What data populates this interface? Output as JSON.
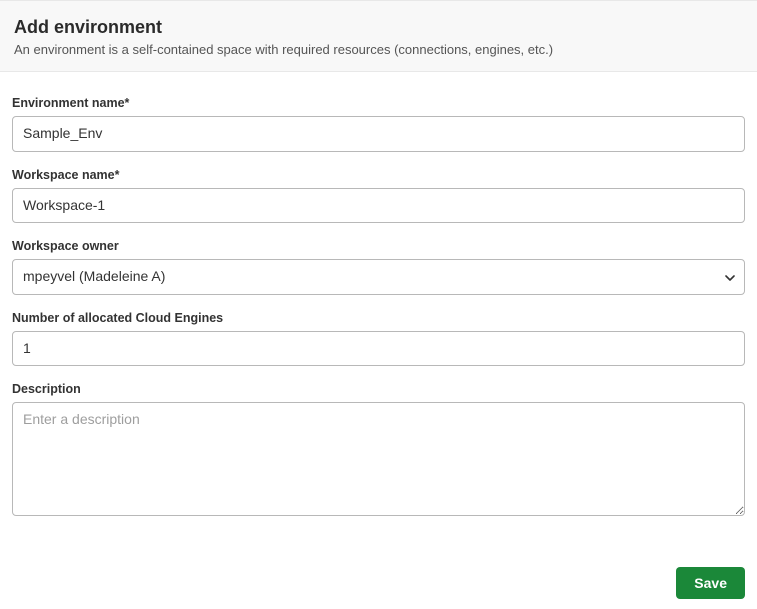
{
  "header": {
    "title": "Add environment",
    "description": "An environment is a self-contained space with required resources (connections, engines, etc.)"
  },
  "form": {
    "envName": {
      "label": "Environment name*",
      "value": "Sample_Env"
    },
    "workspaceName": {
      "label": "Workspace name*",
      "value": "Workspace-1"
    },
    "workspaceOwner": {
      "label": "Workspace owner",
      "selected": "mpeyvel (Madeleine A)"
    },
    "cloudEngines": {
      "label": "Number of allocated Cloud Engines",
      "value": "1"
    },
    "description": {
      "label": "Description",
      "placeholder": "Enter a description",
      "value": ""
    }
  },
  "footer": {
    "save_label": "Save"
  }
}
